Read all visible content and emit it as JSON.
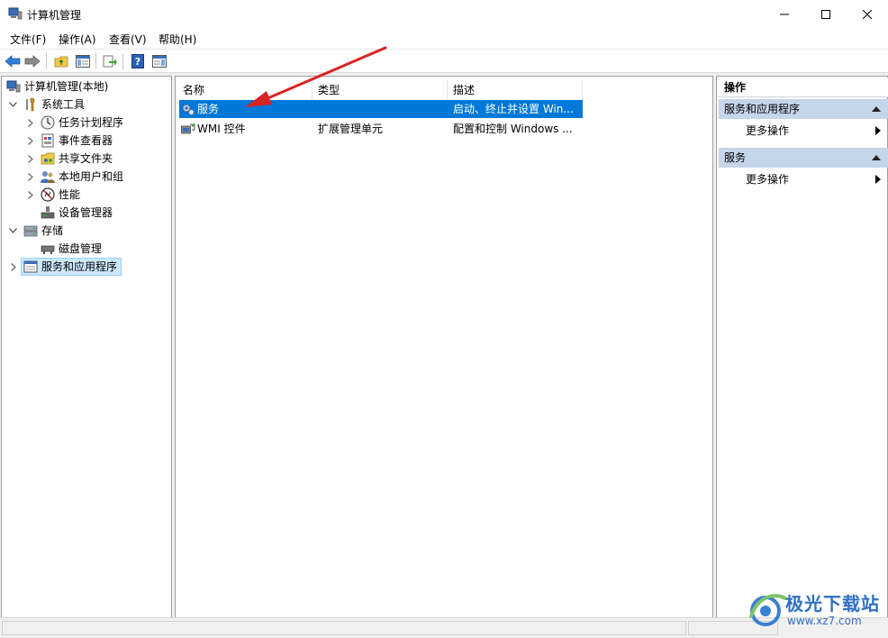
{
  "window": {
    "title": "计算机管理",
    "minimize_glyph": "—",
    "maximize_glyph": "☐",
    "close_glyph": "✕"
  },
  "menu": [
    "文件(F)",
    "操作(A)",
    "查看(V)",
    "帮助(H)"
  ],
  "toolbar": {
    "buttons": [
      "back-icon",
      "forward-icon",
      "up-folder-icon",
      "show-hide-tree-icon",
      "export-list-icon",
      "help-icon",
      "show-action-pane-icon"
    ]
  },
  "tree": {
    "root": "计算机管理(本地)",
    "items": [
      {
        "label": "系统工具",
        "level": 1,
        "expanded": true
      },
      {
        "label": "任务计划程序",
        "level": 2,
        "expanded": false
      },
      {
        "label": "事件查看器",
        "level": 2,
        "expanded": false
      },
      {
        "label": "共享文件夹",
        "level": 2,
        "expanded": false
      },
      {
        "label": "本地用户和组",
        "level": 2,
        "expanded": false
      },
      {
        "label": "性能",
        "level": 2,
        "expanded": false
      },
      {
        "label": "设备管理器",
        "level": 2
      },
      {
        "label": "存储",
        "level": 1,
        "expanded": true
      },
      {
        "label": "磁盘管理",
        "level": 2
      },
      {
        "label": "服务和应用程序",
        "level": 1,
        "expanded": false,
        "selected": true
      }
    ]
  },
  "list": {
    "columns": [
      "名称",
      "类型",
      "描述"
    ],
    "rows": [
      {
        "name": "服务",
        "type": "",
        "desc": "启动、终止并设置 Win...",
        "selected": true
      },
      {
        "name": "WMI 控件",
        "type": "扩展管理单元",
        "desc": "配置和控制 Windows ..."
      }
    ]
  },
  "actions": {
    "header": "操作",
    "sections": [
      {
        "title": "服务和应用程序",
        "items": [
          "更多操作"
        ]
      },
      {
        "title": "服务",
        "items": [
          "更多操作"
        ]
      }
    ]
  },
  "watermark": {
    "site_name": "极光下载站",
    "url": "www.xz7.com"
  },
  "colors": {
    "selection": "#0078d7",
    "section_bg": "#c5d5ea",
    "arrow": "#d92323"
  }
}
